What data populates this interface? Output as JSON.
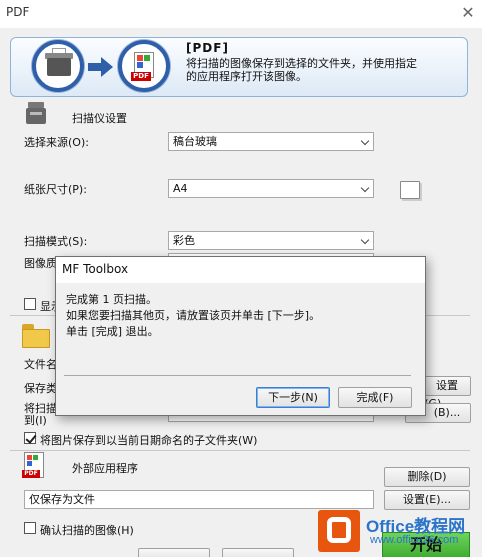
{
  "window": {
    "title": "PDF",
    "close_glyph": "✕"
  },
  "header": {
    "title": "[PDF]",
    "description": "将扫描的图像保存到选择的文件夹，并使用指定的应用程序打开该图像。",
    "pdf_badge": "PDF"
  },
  "scanner_settings": {
    "section_title": "扫描仪设置",
    "source_label": "选择来源(O):",
    "source_value": "稿台玻璃",
    "paper_size_label": "纸张尺寸(P):",
    "paper_size_value": "A4",
    "scan_mode_label": "扫描模式(S):",
    "scan_mode_value": "彩色",
    "quality_label": "图像质",
    "show_checkbox_label": "显示"
  },
  "save_settings": {
    "filename_label": "文件名",
    "save_type_label": "保存类",
    "save_location_label_1": "将扫描",
    "save_location_label_2": "到(I)",
    "settings_g_button": "设置(G)...",
    "browse_b_button": "(B)...",
    "subfolder_checkbox_label": "将图片保存到以当前日期命名的子文件夹(W)",
    "subfolder_checked": true
  },
  "external_app": {
    "section_title": "外部应用程序",
    "app_field_value": "仅保存为文件",
    "delete_button": "删除(D)",
    "settings_button": "设置(E)...",
    "pdf_badge": "PDF"
  },
  "confirm": {
    "checkbox_label": "确认扫描的图像(H)",
    "checked": false
  },
  "dialog": {
    "title": "MF Toolbox",
    "message_line1": "完成第 1 页扫描。",
    "message_line2": "如果您要扫描其他页，请放置该页并单击 [下一步]。",
    "message_line3": "单击 [完成] 退出。",
    "next_button": "下一步(N)",
    "finish_button": "完成(F)"
  },
  "footer": {
    "start_button": "开始"
  },
  "watermark": {
    "brand": "Office教程网",
    "url": "www.office26.com"
  }
}
